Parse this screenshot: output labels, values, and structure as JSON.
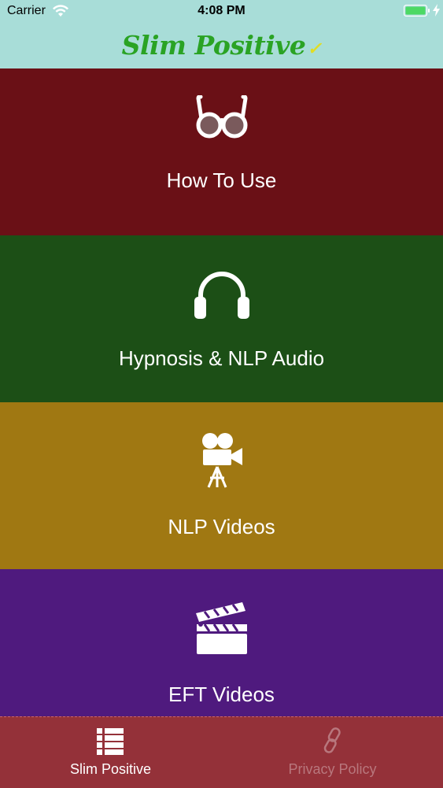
{
  "status_bar": {
    "carrier": "Carrier",
    "time": "4:08 PM"
  },
  "header": {
    "logo": "Slim Positive",
    "logo_check": "✓"
  },
  "tiles": [
    {
      "label": "How To Use",
      "icon": "glasses-icon",
      "color": "#6a1016"
    },
    {
      "label": "Hypnosis & NLP Audio",
      "icon": "headphones-icon",
      "color": "#1c4f16"
    },
    {
      "label": "NLP Videos",
      "icon": "movie-camera-icon",
      "color": "#a07812"
    },
    {
      "label": "EFT Videos",
      "icon": "clapperboard-icon",
      "color": "#4f1a7e"
    }
  ],
  "tabbar": {
    "items": [
      {
        "label": "Slim Positive",
        "icon": "list-icon",
        "active": true
      },
      {
        "label": "Privacy Policy",
        "icon": "link-icon",
        "active": false
      }
    ],
    "background": "#943139"
  }
}
